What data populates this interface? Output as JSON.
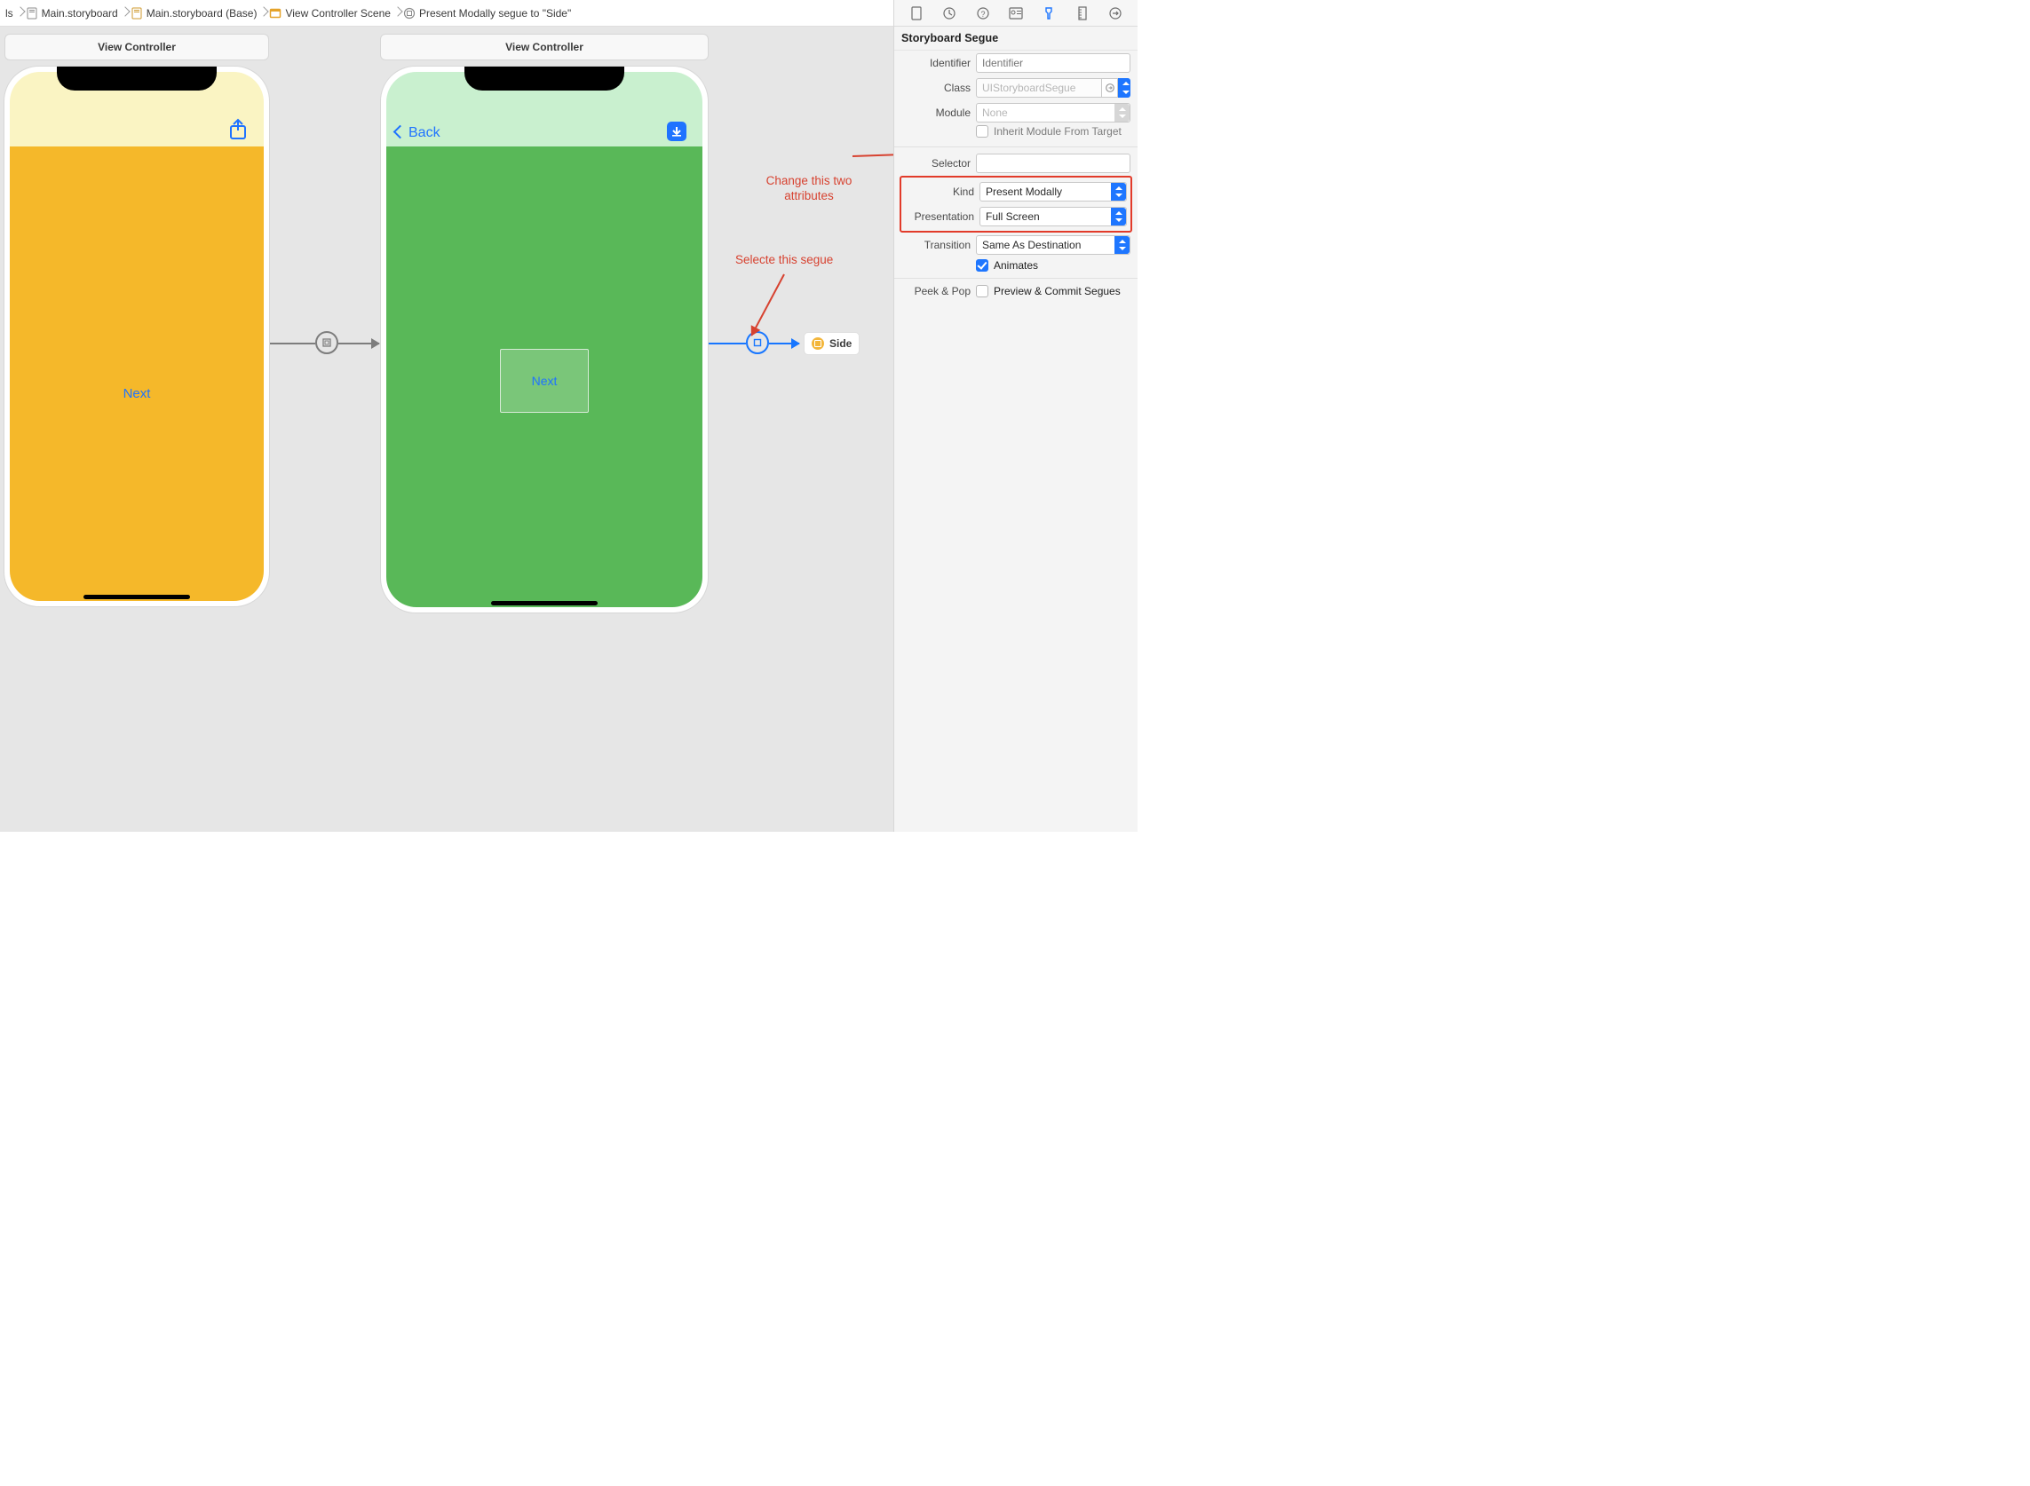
{
  "jumpbar": {
    "crumbs": [
      {
        "label": "ls",
        "icon": "folder-nav"
      },
      {
        "label": "Main.storyboard",
        "icon": "storyboard-file"
      },
      {
        "label": "Main.storyboard (Base)",
        "icon": "storyboard-file"
      },
      {
        "label": "View Controller Scene",
        "icon": "scene-icon"
      },
      {
        "label": "Present Modally segue to \"Side\"",
        "icon": "segue-icon"
      }
    ]
  },
  "toolbar": {
    "warning_badge": "⚠︎"
  },
  "inspector": {
    "section": "Storyboard Segue",
    "identifier_label": "Identifier",
    "identifier_placeholder": "Identifier",
    "class_label": "Class",
    "class_value": "UIStoryboardSegue",
    "module_label": "Module",
    "module_value": "None",
    "inherit_label": "Inherit Module From Target",
    "selector_label": "Selector",
    "kind_label": "Kind",
    "kind_value": "Present Modally",
    "presentation_label": "Presentation",
    "presentation_value": "Full Screen",
    "transition_label": "Transition",
    "transition_value": "Same As Destination",
    "animates_label": "Animates",
    "peekpop_label": "Peek & Pop",
    "peekpop_value": "Preview & Commit Segues"
  },
  "scenes": {
    "left_title": "View Controller",
    "right_title": "View Controller",
    "orange_next_label": "Next",
    "green_back_label": "Back",
    "green_next_label": "Next",
    "side_label": "Side"
  },
  "annotations": {
    "change_text_1": "Change this two",
    "change_text_2": "attributes",
    "select_text": "Selecte this segue"
  }
}
